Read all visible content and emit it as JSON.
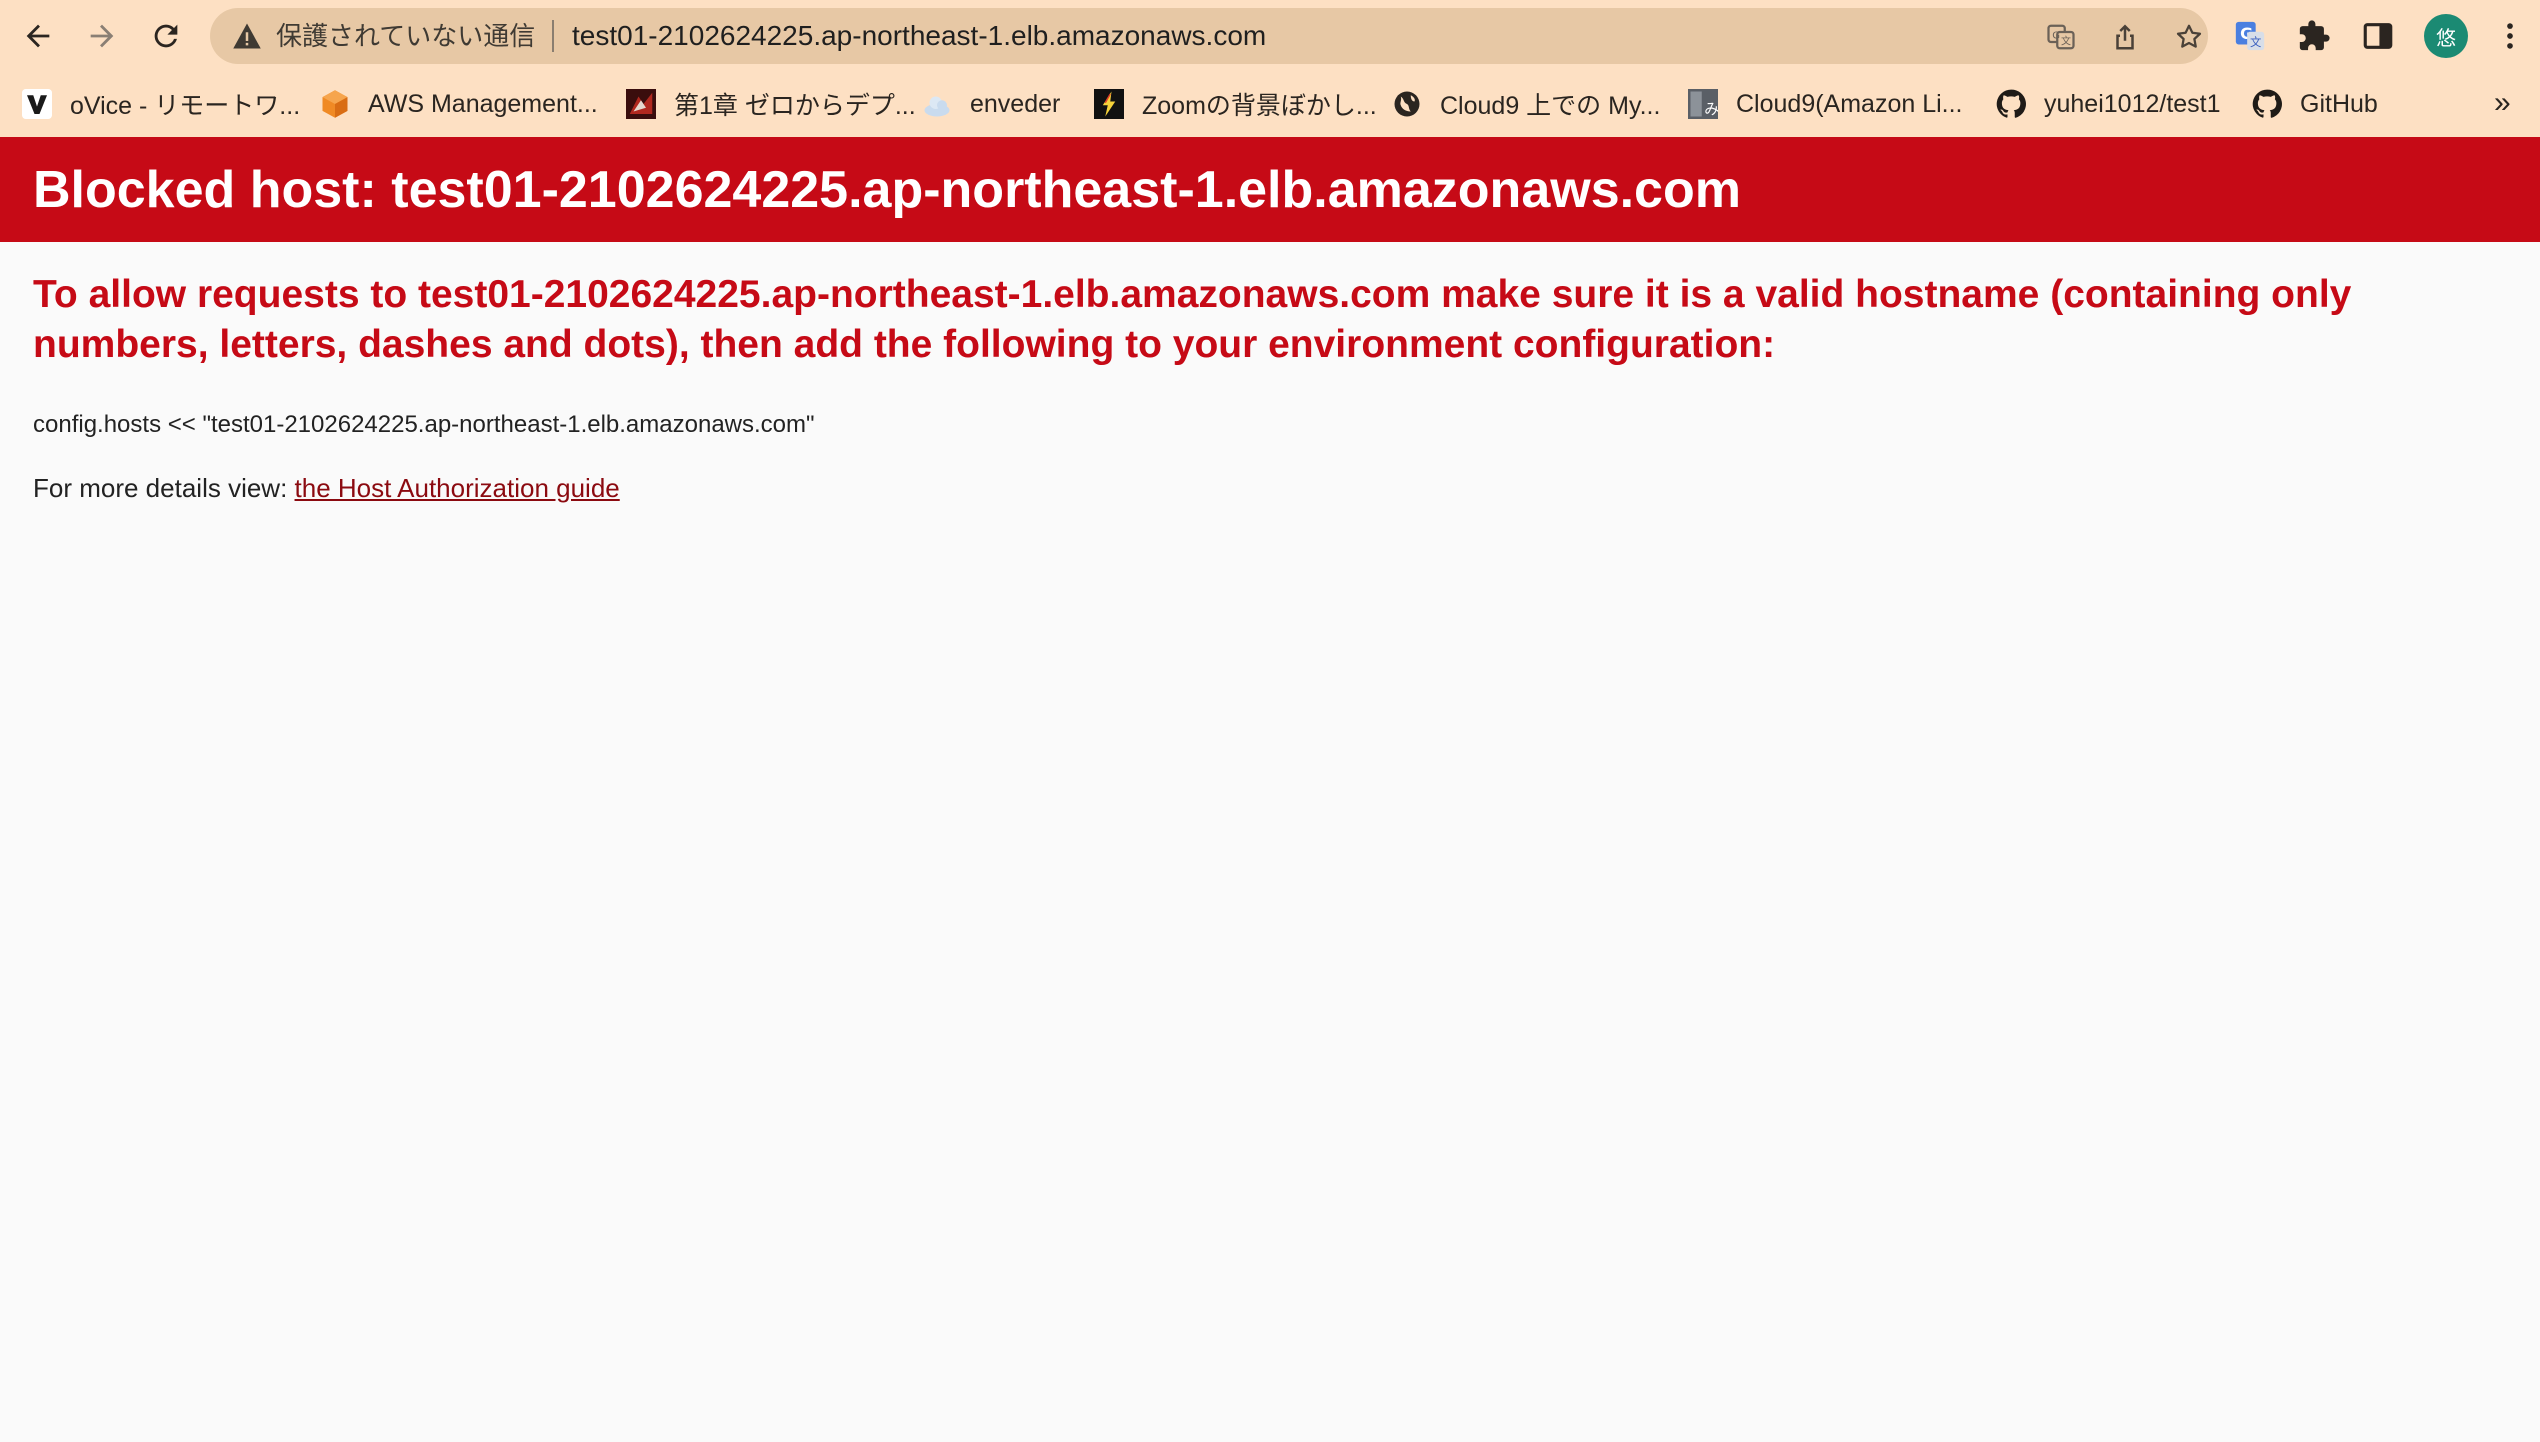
{
  "browser": {
    "security_label": "保護されていない通信",
    "url": "test01-2102624225.ap-northeast-1.elb.amazonaws.com",
    "avatar_initial": "悠",
    "colors": {
      "chrome_bg": "#fde0c3",
      "omnibox_bg": "#e7c8a5",
      "avatar_bg": "#1b8a73"
    }
  },
  "bookmarks": {
    "items": [
      {
        "label": "oVice - リモートワ...",
        "icon": "ovice-icon"
      },
      {
        "label": "AWS Management...",
        "icon": "aws-cube-icon"
      },
      {
        "label": "第1章 ゼロからデプ...",
        "icon": "book-thumbnail-icon"
      },
      {
        "label": "enveder",
        "icon": "cloud-icon"
      },
      {
        "label": "Zoomの背景ぼかし...",
        "icon": "lightning-icon"
      },
      {
        "label": "Cloud9 上での My...",
        "icon": "globe-icon"
      },
      {
        "label": "Cloud9(Amazon Li...",
        "icon": "page-thumbnail-icon"
      },
      {
        "label": "yuhei1012/test1",
        "icon": "github-icon"
      },
      {
        "label": "GitHub",
        "icon": "github-icon"
      }
    ],
    "overflow_label": "»"
  },
  "page": {
    "title": "Blocked host: test01-2102624225.ap-northeast-1.elb.amazonaws.com",
    "subheading": "To allow requests to test01-2102624225.ap-northeast-1.elb.amazonaws.com make sure it is a valid hostname (containing only numbers, letters, dashes and dots), then add the following to your environment configuration:",
    "code": "config.hosts << \"test01-2102624225.ap-northeast-1.elb.amazonaws.com\"",
    "details_prefix": "For more details view: ",
    "details_link": "the Host Authorization guide",
    "colors": {
      "banner": "#c60a16",
      "link": "#8b0a10"
    }
  }
}
